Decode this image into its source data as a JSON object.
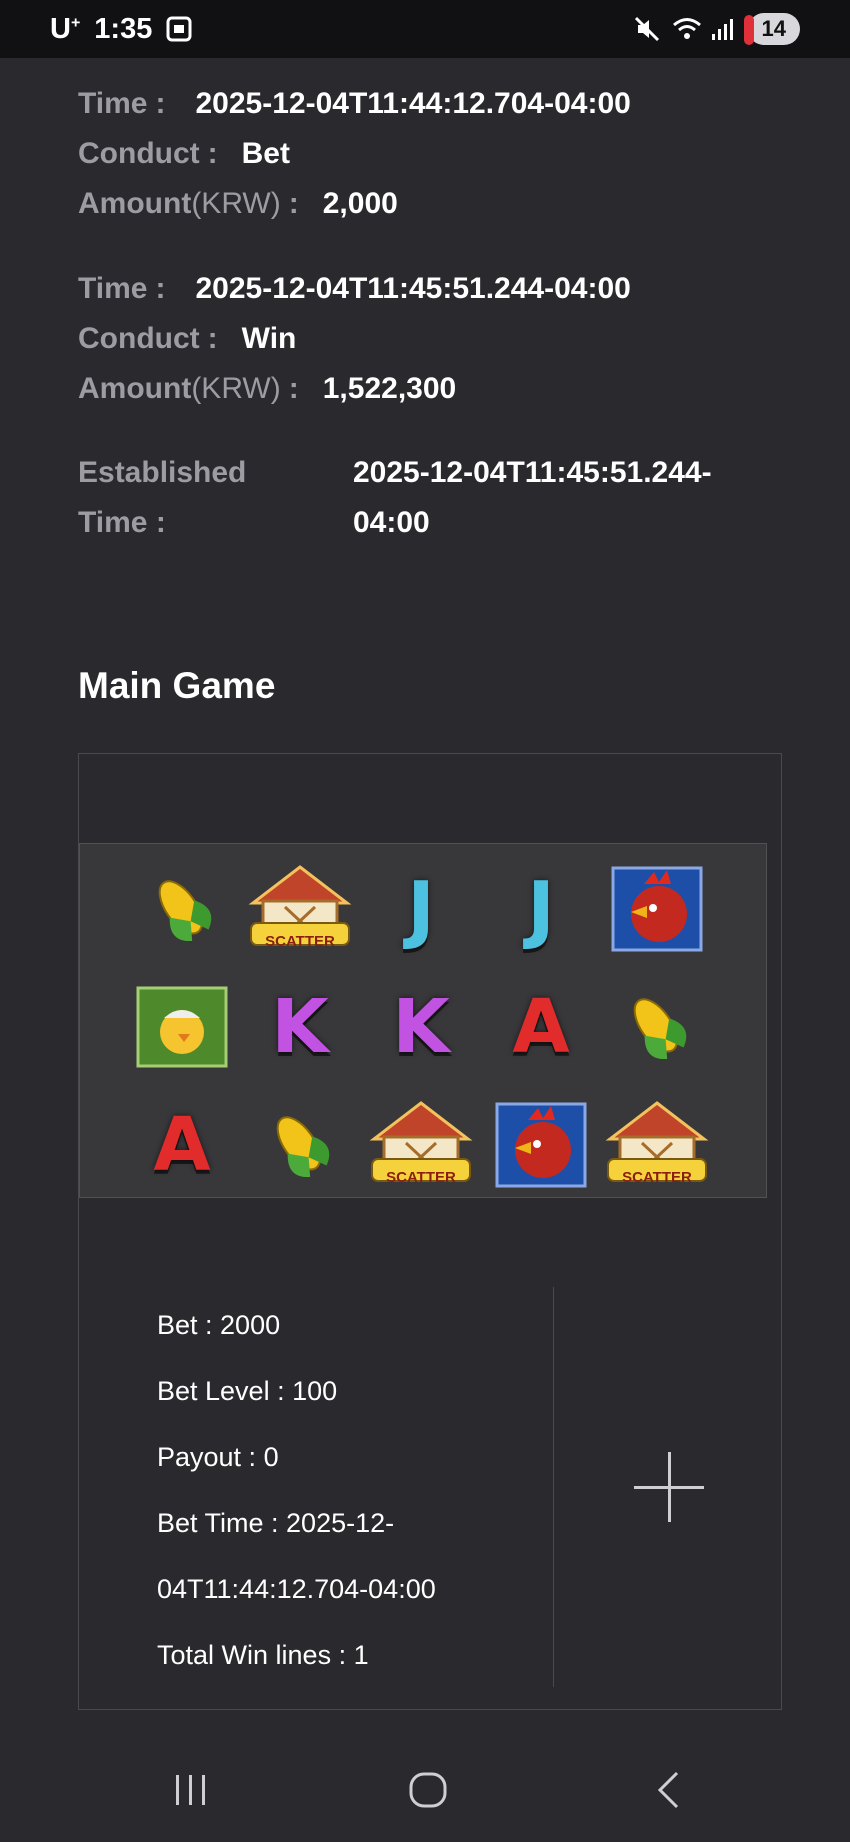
{
  "status_bar": {
    "carrier": "U",
    "carrier_sup": "+",
    "time": "1:35",
    "notification_count": "14"
  },
  "transactions": [
    {
      "time_label": "Time",
      "time_value": "2025-12-04T11:44:12.704-04:00",
      "conduct_label": "Conduct",
      "conduct_value": "Bet",
      "amount_label": "Amount",
      "amount_unit": "(KRW)",
      "amount_value": "2,000"
    },
    {
      "time_label": "Time",
      "time_value": "2025-12-04T11:45:51.244-04:00",
      "conduct_label": "Conduct",
      "conduct_value": "Win",
      "amount_label": "Amount",
      "amount_unit": "(KRW)",
      "amount_value": "1,522,300"
    }
  ],
  "established": {
    "label_line1": "Established",
    "label_line2": "Time :",
    "value_line1": "2025-12-04T11:45:51.244-",
    "value_line2": "04:00"
  },
  "section_title": "Main Game",
  "reel_grid": [
    [
      "corn",
      "scatter-barn",
      "J",
      "J",
      "rooster"
    ],
    [
      "chick",
      "K",
      "K",
      "A",
      "corn"
    ],
    [
      "A",
      "corn",
      "scatter-barn",
      "rooster",
      "scatter-barn"
    ]
  ],
  "scatter_text": "SCATTER",
  "stats": {
    "bet": "Bet : 2000",
    "bet_level": "Bet Level : 100",
    "payout": "Payout : 0",
    "bet_time_line1": "Bet Time : 2025-12-",
    "bet_time_line2": "04T11:44:12.704-04:00",
    "total_win_lines": "Total Win lines : 1"
  },
  "colors": {
    "background": "#2a292e",
    "label_gray": "#9c9ca2",
    "letter_j": "#4cc2e0",
    "letter_k": "#c253e2",
    "letter_a": "#e22b2b"
  }
}
